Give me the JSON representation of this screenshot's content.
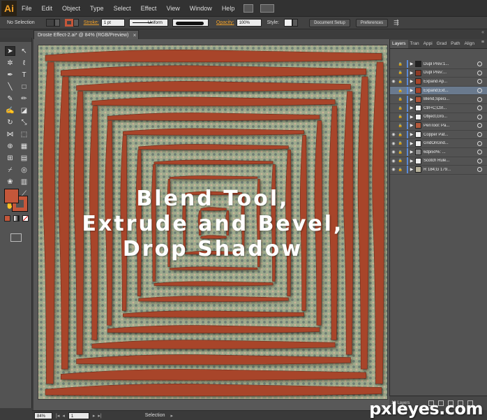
{
  "app": {
    "logo": "Ai",
    "menu": [
      "File",
      "Edit",
      "Object",
      "Type",
      "Select",
      "Effect",
      "View",
      "Window",
      "Help"
    ]
  },
  "controlbar": {
    "selection_label": "No Selection",
    "fill_color": "#c5573a",
    "stroke_link": "Stroke:",
    "stroke_weight": "1 pt",
    "stroke_profile": "Uniform",
    "opacity_link": "Opacity:",
    "opacity_value": "100%",
    "style_label": "Style:",
    "document_setup": "Document Setup",
    "preferences": "Preferences"
  },
  "document": {
    "tab_title": "Droste Effect-2.ai* @ 84% (RGB/Preview)",
    "close_glyph": "×",
    "headline_lines": [
      "Blend Tool,",
      "Extrude and Bevel,",
      "Drop Shadow"
    ],
    "rust_color": "#a8452a"
  },
  "tools": [
    "selection-tool",
    "direct-selection-tool",
    "magic-wand-tool",
    "lasso-tool",
    "pen-tool",
    "type-tool",
    "line-tool",
    "rectangle-tool",
    "paintbrush-tool",
    "pencil-tool",
    "blob-brush-tool",
    "eraser-tool",
    "rotate-tool",
    "scale-tool",
    "width-tool",
    "free-transform-tool",
    "shape-builder-tool",
    "perspective-grid-tool",
    "mesh-tool",
    "gradient-tool",
    "eyedropper-tool",
    "blend-tool",
    "symbol-sprayer-tool",
    "column-graph-tool",
    "artboard-tool",
    "slice-tool",
    "hand-tool",
    "zoom-tool"
  ],
  "status": {
    "zoom": "84%",
    "page": "1",
    "tool_name": "Selection"
  },
  "layers_panel": {
    "tabs": [
      "Layers",
      "Tran",
      "Appi",
      "Grad",
      "Path",
      "Align"
    ],
    "menu_glyph": "≡",
    "collapse_glyph": "«",
    "layers": [
      {
        "name": "Dupl Prev:1...",
        "visible": false,
        "selected": false,
        "thumb": "#222222"
      },
      {
        "name": "Dupl Prev:...",
        "visible": false,
        "selected": false,
        "thumb": "#8a3a26"
      },
      {
        "name": "Expand Ap...",
        "visible": true,
        "selected": false,
        "thumb": "#a8452a"
      },
      {
        "name": "Expand;Ext...",
        "visible": false,
        "selected": true,
        "thumb": "#a8452a"
      },
      {
        "name": "Blend,Speci...",
        "visible": false,
        "selected": false,
        "thumb": "#b0563a"
      },
      {
        "name": "Ctrl+C;Ctrl...",
        "visible": false,
        "selected": false,
        "thumb": "#eeeeee"
      },
      {
        "name": "Object,Gro...",
        "visible": false,
        "selected": false,
        "thumb": "#eeeeee"
      },
      {
        "name": "PenTool: Pa...",
        "visible": false,
        "selected": false,
        "thumb": "#b45a3c"
      },
      {
        "name": "Copper Pat...",
        "visible": true,
        "selected": false,
        "thumb": "#eeeeee"
      },
      {
        "name": "GridOnGrid...",
        "visible": true,
        "selected": false,
        "thumb": "#eeeeee"
      },
      {
        "name": "6dpi50%: ...",
        "visible": true,
        "selected": false,
        "thumb": "#8c8c8c"
      },
      {
        "name": "Scotch Rule...",
        "visible": true,
        "selected": false,
        "thumb": "#eeeeee"
      },
      {
        "name": "R 184;G 179...",
        "visible": true,
        "selected": false,
        "thumb": "#b8b39c"
      }
    ],
    "count_label": "13 Layers"
  },
  "watermark": "pxleyes.com"
}
